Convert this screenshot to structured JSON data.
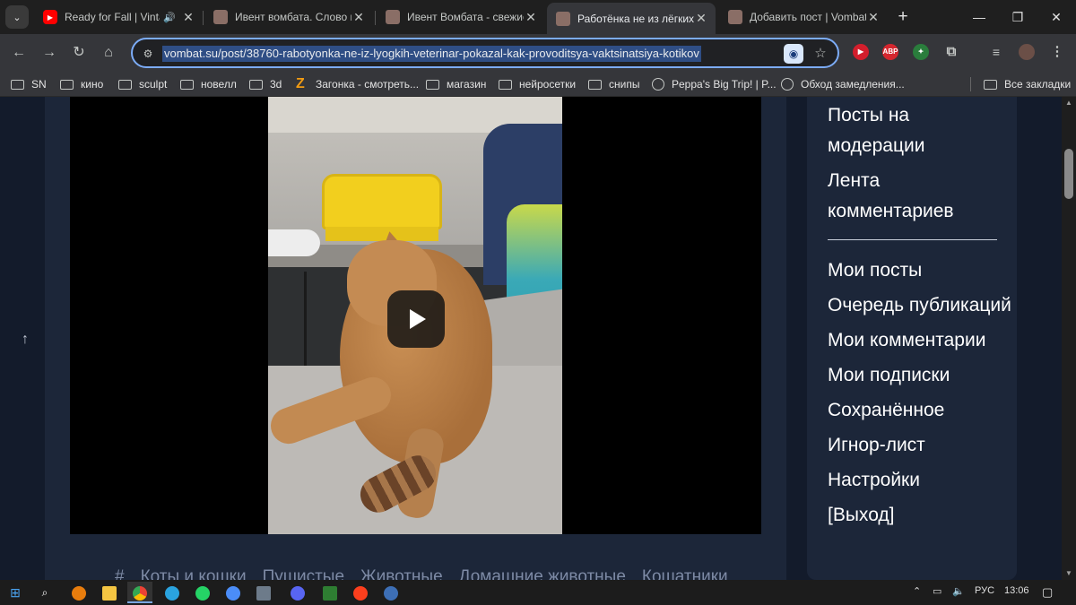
{
  "tabs": [
    {
      "title": "Ready for Fall | Vintage",
      "favicon": "youtube-icon",
      "audio": true,
      "active": false
    },
    {
      "title": "Ивент вомбата. Слово н",
      "favicon": "wombat-icon",
      "active": false
    },
    {
      "title": "Ивент Вомбата - свежие",
      "favicon": "wombat-icon",
      "active": false
    },
    {
      "title": "Работёнка не из лёгких",
      "favicon": "wombat-icon",
      "active": true
    },
    {
      "title": "Добавить пост | Vombat",
      "favicon": "wombat-icon",
      "active": false
    }
  ],
  "toolbar": {
    "url": "vombat.su/post/38760-rabotyonka-ne-iz-lyogkih-veterinar-pokazal-kak-provoditsya-vaktsinatsiya-kotikov",
    "ext_abp": "ABP"
  },
  "bookmarks": [
    {
      "label": "SN",
      "icon": "folder-icon"
    },
    {
      "label": "кино",
      "icon": "folder-icon"
    },
    {
      "label": "sculpt",
      "icon": "folder-icon"
    },
    {
      "label": "новелл",
      "icon": "folder-icon"
    },
    {
      "label": "3d",
      "icon": "folder-icon"
    },
    {
      "label": "Загонка - смотреть...",
      "icon": "zagonka-icon"
    },
    {
      "label": "магазин",
      "icon": "folder-icon"
    },
    {
      "label": "нейросетки",
      "icon": "folder-icon"
    },
    {
      "label": "снипы",
      "icon": "folder-icon"
    },
    {
      "label": "Peppa's Big Trip! | P...",
      "icon": "globe-icon"
    },
    {
      "label": "Обход замедления...",
      "icon": "github-icon"
    }
  ],
  "all_bookmarks": "Все закладки",
  "post": {
    "tags": [
      "Коты и кошки",
      "Пушистые",
      "Животные",
      "Домашние животные",
      "Кошатники"
    ]
  },
  "sidebar": {
    "menu_top": [
      "Посты на модерации",
      "Лента комментариев"
    ],
    "menu_bottom": [
      "Мои посты",
      "Очередь публикаций",
      "Мои комментарии",
      "Мои подписки",
      "Сохранённое",
      "Игнор-лист",
      "Настройки",
      "[Выход]"
    ]
  },
  "taskbar": {
    "lang": "РУС",
    "time": "13:06"
  },
  "colors": {
    "page_bg": "#131b2b",
    "card_bg": "#1c2639",
    "url_highlight": "#2f4e85",
    "omnibox_border": "#7cacf8"
  }
}
